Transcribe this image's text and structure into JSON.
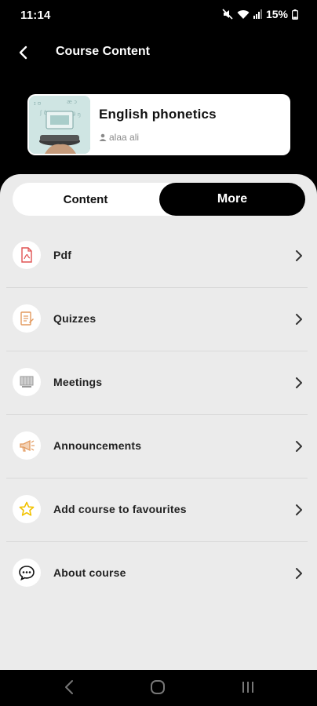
{
  "status_bar": {
    "time": "11:14",
    "battery": "15%",
    "icons": [
      "mute-icon",
      "wifi-icon",
      "signal-icon",
      "battery-icon"
    ]
  },
  "header": {
    "title": "Course Content",
    "back_icon": "back-arrow-icon"
  },
  "course": {
    "name": "English phonetics",
    "author": "alaa ali"
  },
  "tabs": [
    {
      "label": "Content",
      "active": false
    },
    {
      "label": "More",
      "active": true
    }
  ],
  "menu": [
    {
      "label": "Pdf",
      "icon": "pdf-icon",
      "color": "#e05353"
    },
    {
      "label": "Quizzes",
      "icon": "quiz-icon",
      "color": "#e39a5e"
    },
    {
      "label": "Meetings",
      "icon": "meetings-icon",
      "color": "#9a9a9a"
    },
    {
      "label": "Announcements",
      "icon": "megaphone-icon",
      "color": "#e39a5e"
    },
    {
      "label": "Add course to favourites",
      "icon": "star-icon",
      "color": "#f2c200"
    },
    {
      "label": "About course",
      "icon": "chat-icon",
      "color": "#111111"
    }
  ],
  "colors": {
    "background": "#000000",
    "panel": "#ebebeb",
    "active_tab": "#000000"
  }
}
